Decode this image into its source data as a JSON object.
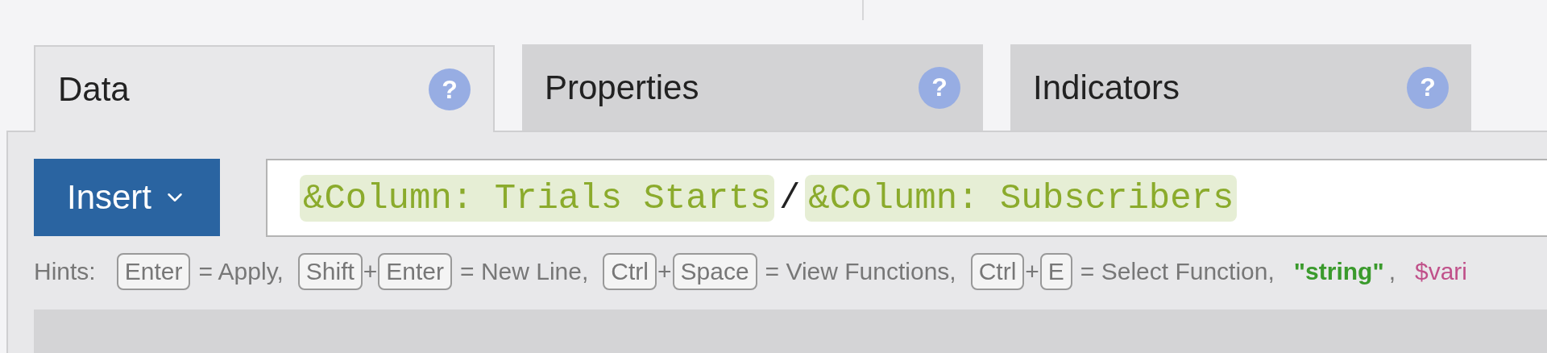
{
  "tabs": [
    {
      "label": "Data",
      "help": "?",
      "selected": true
    },
    {
      "label": "Properties",
      "help": "?",
      "selected": false
    },
    {
      "label": "Indicators",
      "help": "?",
      "selected": false
    }
  ],
  "insert_button": {
    "label": "Insert"
  },
  "expression": [
    {
      "kind": "column",
      "text": "&Column: Trials Starts"
    },
    {
      "kind": "operator",
      "text": "/"
    },
    {
      "kind": "column",
      "text": "&Column: Subscribers"
    }
  ],
  "hints": {
    "label": "Hints:",
    "items": [
      {
        "kind": "key",
        "text": "Enter"
      },
      {
        "kind": "text",
        "text": "= Apply,"
      },
      {
        "kind": "key",
        "text": "Shift"
      },
      {
        "kind": "plus",
        "text": "+"
      },
      {
        "kind": "key",
        "text": "Enter"
      },
      {
        "kind": "text",
        "text": "= New Line,"
      },
      {
        "kind": "key",
        "text": "Ctrl"
      },
      {
        "kind": "plus",
        "text": "+"
      },
      {
        "kind": "key",
        "text": "Space"
      },
      {
        "kind": "text",
        "text": "= View Functions,"
      },
      {
        "kind": "key",
        "text": "Ctrl"
      },
      {
        "kind": "plus",
        "text": "+"
      },
      {
        "kind": "key",
        "text": "E"
      },
      {
        "kind": "text",
        "text": "= Select Function,"
      },
      {
        "kind": "string",
        "text": "\"string\""
      },
      {
        "kind": "text",
        "text": ","
      },
      {
        "kind": "variable",
        "text": "$vari"
      }
    ]
  }
}
